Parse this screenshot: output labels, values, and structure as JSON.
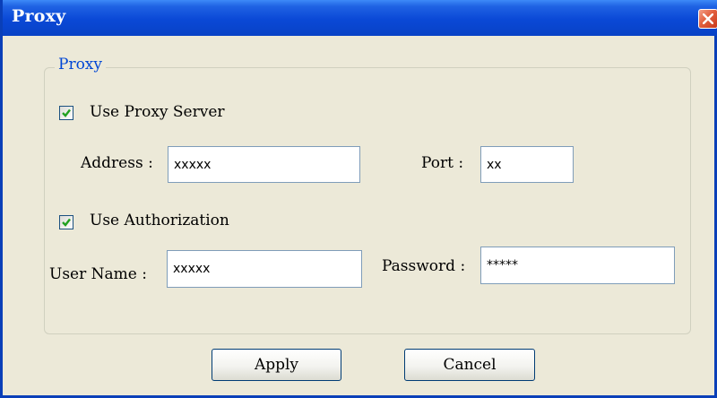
{
  "window": {
    "title": "Proxy"
  },
  "group": {
    "legend": "Proxy"
  },
  "proxy_server": {
    "checkbox_label": "Use Proxy Server",
    "checked": true,
    "address_label": "Address :",
    "address_value": "xxxxx",
    "port_label": "Port :",
    "port_value": "xx"
  },
  "authorization": {
    "checkbox_label": "Use Authorization",
    "checked": true,
    "username_label": "User Name :",
    "username_value": "xxxxx",
    "password_label": "Password :",
    "password_value": "*****"
  },
  "buttons": {
    "apply_label": "Apply",
    "cancel_label": "Cancel"
  },
  "colors": {
    "titlebar": "#0a48d6",
    "dialog_background": "#ece9d8",
    "legend_text": "#0046d5",
    "checkmark": "#21a121",
    "close_button": "#e2603f"
  },
  "icons": {
    "close": "close-x-icon",
    "check": "checkmark-icon"
  }
}
